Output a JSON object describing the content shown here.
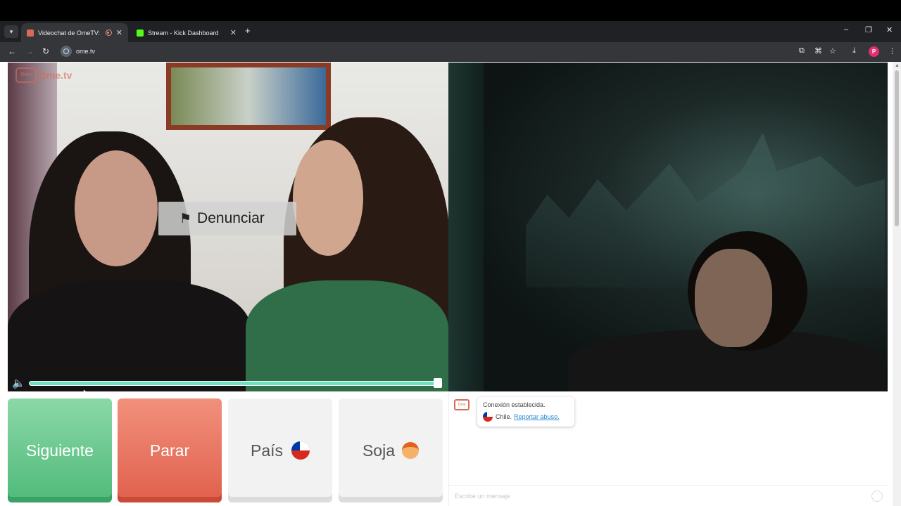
{
  "browser": {
    "tabs": [
      {
        "title": "Videochat de OmeTV: una",
        "active": true
      },
      {
        "title": "Stream - Kick Dashboard",
        "active": false
      }
    ],
    "url": "ome.tv",
    "profile_initial": "P"
  },
  "video": {
    "logo_text": "Ome.tv",
    "report_label": "Denunciar",
    "volume_level": 1.0
  },
  "controls": {
    "next_label": "Siguiente",
    "stop_label": "Parar",
    "country_label": "País",
    "gender_label": "Soja"
  },
  "chat": {
    "status_text": "Conexión establecida.",
    "country": "Chile",
    "separator": ".",
    "report_link": "Reportar abuso.",
    "input_placeholder": "Escribe un mensaje"
  },
  "colors": {
    "next": "#5cc486",
    "stop": "#e8705b",
    "accent": "#d86b57"
  }
}
